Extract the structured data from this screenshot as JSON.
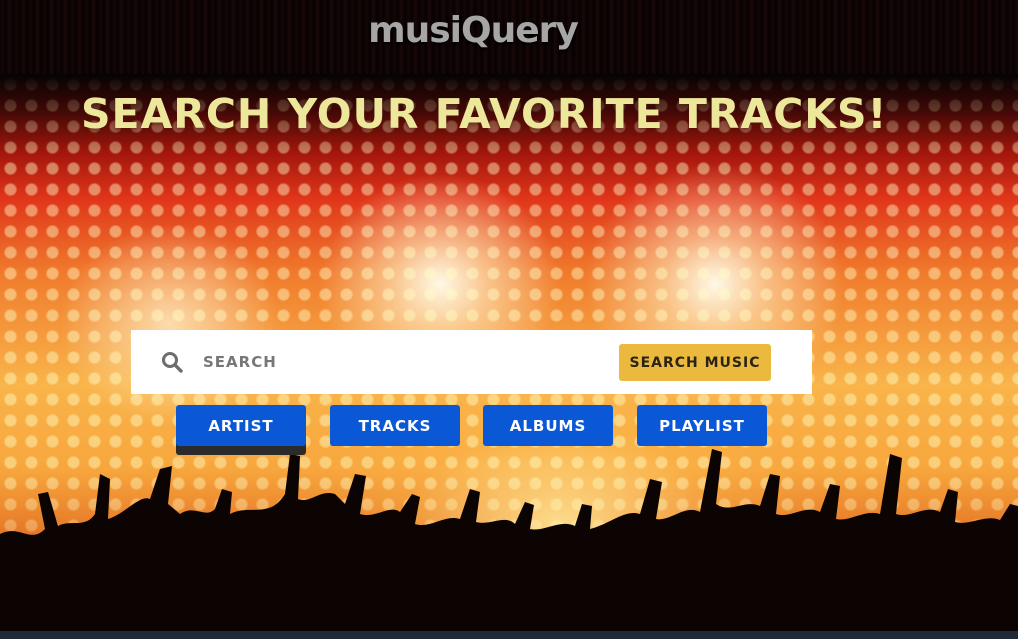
{
  "app": {
    "logo_text": "musiQuery"
  },
  "hero": {
    "headline": "Search your favorite tracks!"
  },
  "search": {
    "placeholder": "Search",
    "value": "",
    "button_label": "Search Music",
    "icon": "search-icon"
  },
  "tabs": [
    {
      "label": "Artist",
      "active": true
    },
    {
      "label": "Tracks",
      "active": false
    },
    {
      "label": "Albums",
      "active": false
    },
    {
      "label": "Playlist",
      "active": false
    }
  ],
  "colors": {
    "headline": "#ede79c",
    "search_button": "#eab93e",
    "tab_button": "#0a58d6",
    "logo": "#a6a6a6"
  }
}
